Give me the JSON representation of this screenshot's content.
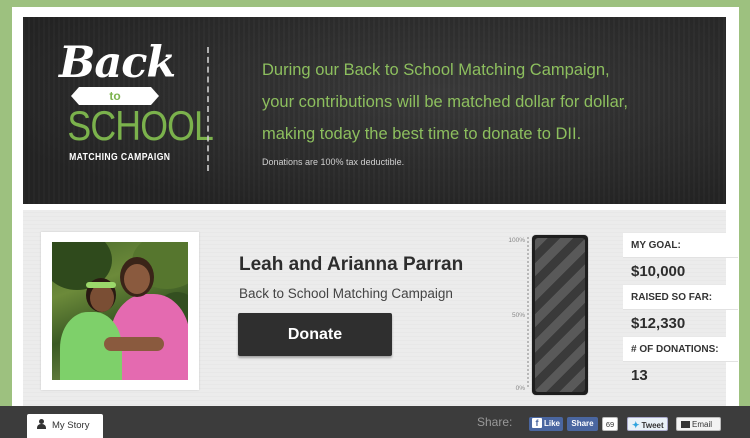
{
  "banner": {
    "logo": {
      "back": "Back",
      "to": "to",
      "school": "SCHOOL",
      "subtitle": "MATCHING CAMPAIGN"
    },
    "message_lines": [
      "During our Back to School Matching Campaign,",
      "your contributions will be matched dollar for dollar,",
      "making today the best time to donate to DII."
    ],
    "note": "Donations are 100% tax deductible."
  },
  "fundraiser": {
    "name": "Leah and Arianna Parran",
    "campaign": "Back to School Matching Campaign",
    "donate_label": "Donate"
  },
  "thermometer": {
    "ticks": [
      "100%",
      "50%",
      "0%"
    ],
    "progress_percent": 100
  },
  "stats": {
    "goal_label": "MY GOAL:",
    "goal_value": "$10,000",
    "raised_label": "RAISED SO FAR:",
    "raised_value": "$12,330",
    "donations_label": "# OF DONATIONS:",
    "donations_value": "13"
  },
  "bottom_bar": {
    "story_tab": "My Story",
    "share_label": "Share:",
    "fb_like": "Like",
    "fb_share": "Share",
    "share_count": "69",
    "tweet": "Tweet",
    "email": "Email"
  },
  "colors": {
    "page_bg": "#9dc17f",
    "banner_bg": "#2e2e2e",
    "accent_green": "#8dbf5e",
    "facebook_blue": "#4a66a0"
  },
  "icons": [
    "user-icon",
    "facebook-icon",
    "twitter-icon",
    "envelope-icon"
  ]
}
